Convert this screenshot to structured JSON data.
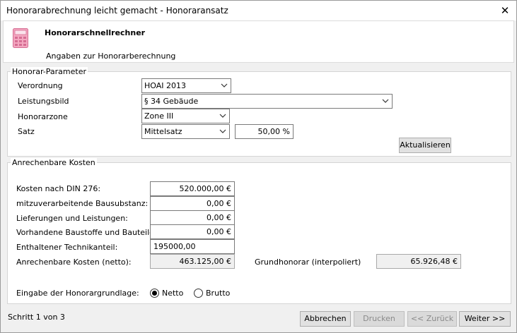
{
  "window": {
    "title": "Honorarabrechnung leicht gemacht - Honoraransatz",
    "close_glyph": "✕"
  },
  "header": {
    "title": "Honorarschnellrechner",
    "subtitle": "Angaben zur Honorarberechnung",
    "icon": "calculator-icon"
  },
  "params": {
    "caption": "Honorar-Parameter",
    "verordnung_label": "Verordnung",
    "verordnung_value": "HOAI 2013",
    "leistungsbild_label": "Leistungsbild",
    "leistungsbild_value": "§ 34 Gebäude",
    "honorarzone_label": "Honorarzone",
    "honorarzone_value": "Zone III",
    "satz_label": "Satz",
    "satz_value": "Mittelsatz",
    "satz_percent": "50,00 %",
    "update_button": "Aktualisieren"
  },
  "costs": {
    "caption": "Anrechenbare Kosten",
    "din276_label": "Kosten nach DIN 276:",
    "din276_value": "520.000,00 €",
    "bausubstanz_label": "mitzuverarbeitende Bausubstanz:",
    "bausubstanz_value": "0,00 €",
    "lieferungen_label": "Lieferungen und Leistungen:",
    "lieferungen_value": "0,00 €",
    "baustoffe_label": "Vorhandene Baustoffe und Bauteile:",
    "baustoffe_value": "0,00 €",
    "technik_label": "Enthaltener Technikanteil:",
    "technik_value": "195000,00",
    "netto_label": "Anrechenbare Kosten (netto):",
    "netto_value": "463.125,00 €",
    "grundhonorar_label": "Grundhonorar (interpoliert)",
    "grundhonorar_value": "65.926,48 €",
    "basis_label": "Eingabe der Honorargrundlage:",
    "radio_netto": "Netto",
    "radio_brutto": "Brutto",
    "selected_basis": "Netto"
  },
  "footer": {
    "status": "Schritt 1 von 3",
    "cancel": "Abbrechen",
    "print": "Drucken",
    "back": "<< Zurück",
    "next": "Weiter >>"
  }
}
